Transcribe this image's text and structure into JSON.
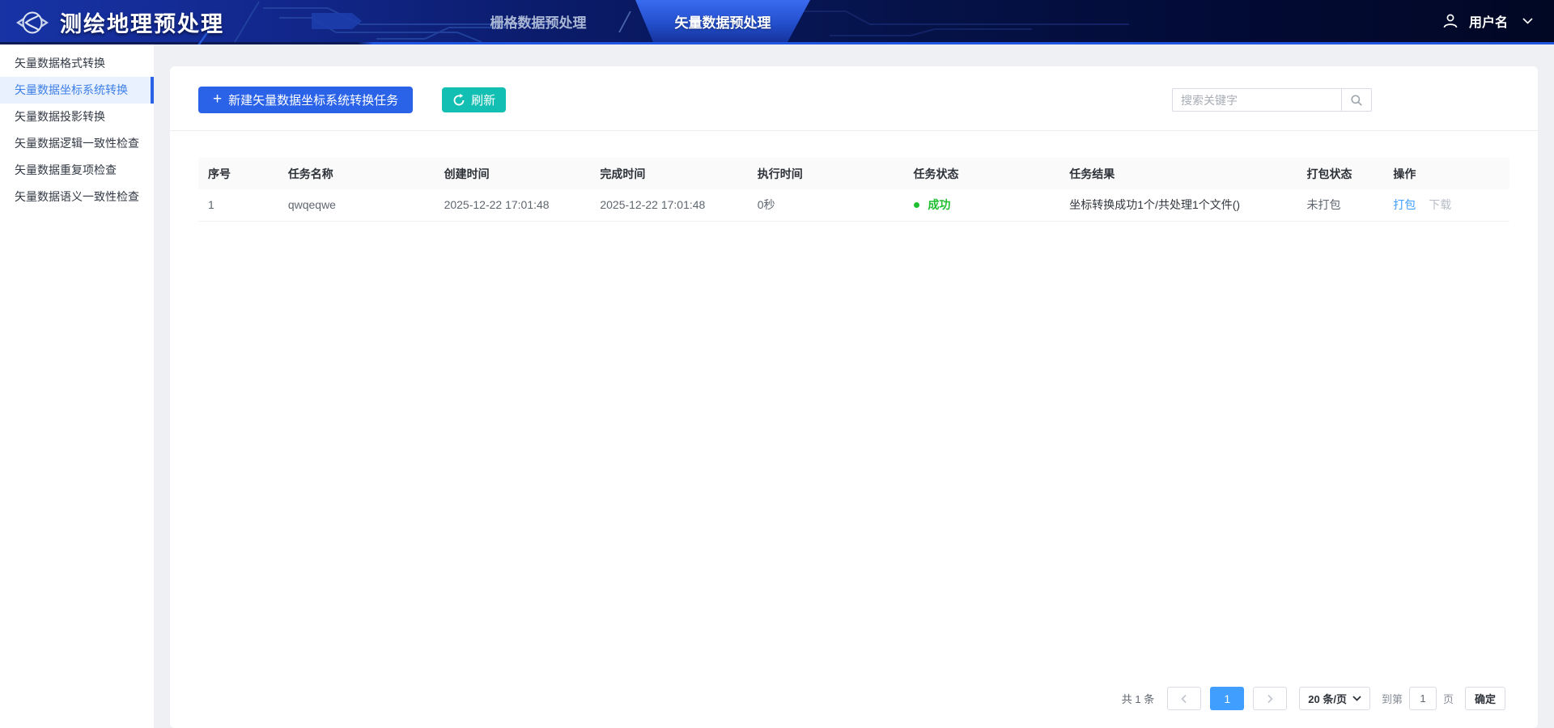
{
  "header": {
    "app_title": "测绘地理预处理",
    "tabs": [
      {
        "label": "栅格数据预处理",
        "active": false
      },
      {
        "label": "矢量数据预处理",
        "active": true
      }
    ],
    "user": {
      "name": "用户名"
    }
  },
  "sidebar": {
    "items": [
      {
        "label": "矢量数据格式转换",
        "active": false
      },
      {
        "label": "矢量数据坐标系统转换",
        "active": true
      },
      {
        "label": "矢量数据投影转换",
        "active": false
      },
      {
        "label": "矢量数据逻辑一致性检查",
        "active": false
      },
      {
        "label": "矢量数据重复项检查",
        "active": false
      },
      {
        "label": "矢量数据语义一致性检查",
        "active": false
      }
    ]
  },
  "toolbar": {
    "new_task_label": "新建矢量数据坐标系统转换任务",
    "refresh_label": "刷新",
    "search_placeholder": "搜索关键字"
  },
  "table": {
    "columns": [
      "序号",
      "任务名称",
      "创建时间",
      "完成时间",
      "执行时间",
      "任务状态",
      "任务结果",
      "打包状态",
      "操作"
    ],
    "rows": [
      {
        "index": "1",
        "name": "qwqeqwe",
        "created": "2025-12-22 17:01:48",
        "finished": "2025-12-22 17:01:48",
        "duration": "0秒",
        "status": "成功",
        "result": "坐标转换成功1个/共处理1个文件()",
        "pack_status": "未打包",
        "action_pack": "打包",
        "action_download": "下载"
      }
    ]
  },
  "pagination": {
    "total_text": "共 1 条",
    "current_page": "1",
    "page_size_label": "20 条/页",
    "goto_prefix": "到第",
    "goto_value": "1",
    "goto_suffix": "页",
    "confirm_label": "确定"
  },
  "icons": {
    "logo": "winged-globe-emblem",
    "user": "person-outline",
    "user_dropdown": "chevron-down",
    "new_task": "plus",
    "refresh": "circular-arrow",
    "search": "magnifier",
    "prev_page": "chevron-left",
    "next_page": "chevron-right",
    "page_size_dropdown": "chevron-down",
    "status": "green-dot"
  },
  "colors": {
    "primary_blue": "#2a62e8",
    "refresh_teal": "#13bfb2",
    "success_green": "#1fbf2f",
    "link_blue": "#409eff",
    "active_page_blue": "#409eff",
    "header_navy": "#051247",
    "sidebar_active_bg": "#e8f1fd"
  }
}
